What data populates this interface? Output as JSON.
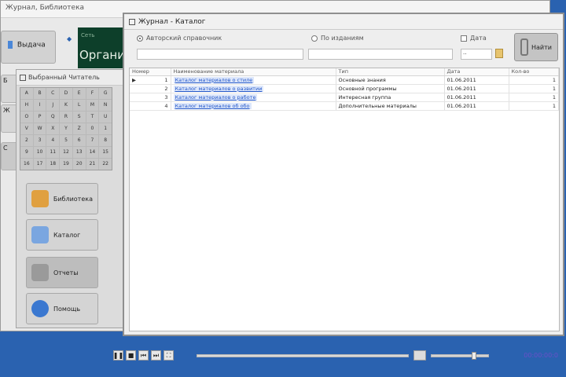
{
  "main_window": {
    "title": "Журнал, Библиотека",
    "big_button_label": "Выдача",
    "left_stub_labels": [
      "Б",
      "Ж",
      "С"
    ],
    "banner_text": "Организ",
    "banner_sub": "Сеть"
  },
  "keyboard_panel": {
    "title": "Выбранный Читатель",
    "keys": [
      "A",
      "B",
      "C",
      "D",
      "E",
      "F",
      "G",
      "H",
      "I",
      "J",
      "K",
      "L",
      "M",
      "N",
      "O",
      "P",
      "Q",
      "R",
      "S",
      "T",
      "U",
      "V",
      "W",
      "X",
      "Y",
      "Z",
      "0",
      "1",
      "2",
      "3",
      "4",
      "5",
      "6",
      "7",
      "8",
      "9",
      "10",
      "11",
      "12",
      "13",
      "14",
      "15",
      "16",
      "17",
      "18",
      "19",
      "20",
      "21",
      "22"
    ],
    "buttons": [
      {
        "label": "Библиотека",
        "icon": "books-icon",
        "color": "#e0a040"
      },
      {
        "label": "Каталог",
        "icon": "document-icon",
        "color": "#7aa6e0"
      },
      {
        "label": "Отчеты",
        "icon": "pencil-icon",
        "color": "#9a9a9a"
      },
      {
        "label": "Помощь",
        "icon": "help-icon",
        "color": "#3b78d0"
      }
    ]
  },
  "journal": {
    "title": "Журнал - Каталог",
    "filters": {
      "radio1_label": "Авторский справочник",
      "radio2_label": "По изданиям",
      "check_label": "Дата",
      "date_value": ".."
    },
    "find_label": "Найти",
    "columns": [
      "Номер",
      "Наименование материала",
      "Тип",
      "Дата",
      "Кол-во"
    ],
    "rows": [
      {
        "indicator": "▶",
        "num": "1",
        "name": "Каталог материалов о стиле",
        "type": "Основные знания",
        "date": "01.06.2011",
        "qty": "1"
      },
      {
        "indicator": "",
        "num": "2",
        "name": "Каталог материалов о развитии",
        "type": "Основной программы",
        "date": "01.06.2011",
        "qty": "1"
      },
      {
        "indicator": "",
        "num": "3",
        "name": "Каталог материалов о работе",
        "type": "Интересная группа",
        "date": "01.06.2011",
        "qty": "1"
      },
      {
        "indicator": "",
        "num": "4",
        "name": "Каталог материалов об обо",
        "type": "Дополнительные материалы",
        "date": "01.06.2011",
        "qty": "1"
      }
    ]
  },
  "player": {
    "progress": 0.0,
    "volume": 0.75,
    "clock": "00:00:00:0"
  }
}
